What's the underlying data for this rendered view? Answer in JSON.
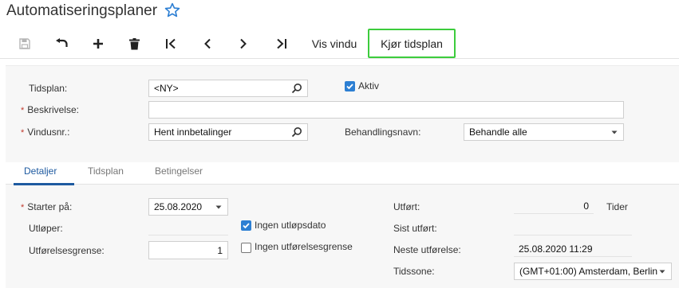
{
  "header": {
    "title": "Automatiseringsplaner"
  },
  "toolbar": {
    "save": "save-icon",
    "undo": "undo-icon",
    "add": "plus-icon",
    "delete": "trash-icon",
    "first": "first-record-icon",
    "prev": "chevron-left-icon",
    "next": "chevron-right-icon",
    "last": "last-record-icon",
    "show_window_label": "Vis vindu",
    "run_schedule_label": "Kjør tidsplan"
  },
  "form": {
    "schedule_label": "Tidsplan:",
    "schedule_value": "<NY>",
    "active_label": "Aktiv",
    "active_checked": true,
    "description_label": "Beskrivelse:",
    "description_value": "",
    "screen_id_label": "Vindusnr.:",
    "screen_id_value": "Hent innbetalinger",
    "action_name_label": "Behandlingsnavn:",
    "action_name_value": "Behandle alle",
    "required_mark": "*"
  },
  "tabs": [
    {
      "label": "Detaljer",
      "active": true
    },
    {
      "label": "Tidsplan",
      "active": false
    },
    {
      "label": "Betingelser",
      "active": false
    }
  ],
  "details": {
    "starts_on_label": "Starter på:",
    "starts_on_value": "25.08.2020",
    "expires_label": "Utløper:",
    "expires_value": "",
    "no_expiration_label": "Ingen utløpsdato",
    "no_expiration_checked": true,
    "execution_limit_label": "Utførelsesgrense:",
    "execution_limit_value": "1",
    "no_execution_limit_label": "Ingen utførelsesgrense",
    "no_execution_limit_checked": false,
    "executed_label": "Utført:",
    "executed_value": "0",
    "times_label": "Tider",
    "last_executed_label": "Sist utført:",
    "last_executed_value": "",
    "next_execution_label": "Neste utførelse:",
    "next_execution_value": "25.08.2020 11:29",
    "timezone_label": "Tidssone:",
    "timezone_value": "(GMT+01:00) Amsterdam, Berlin"
  },
  "colors": {
    "accent": "#1e5aa0",
    "checkbox": "#2d7fd3",
    "highlight": "#3ccc3c",
    "required": "#c0392b"
  }
}
